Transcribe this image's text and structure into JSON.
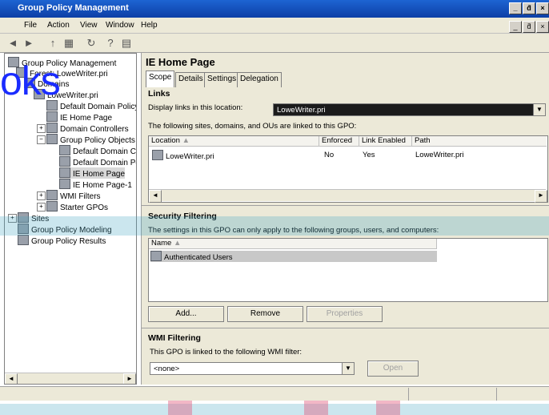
{
  "window": {
    "title": "Group Policy Management",
    "controls": [
      "_",
      "ƌ",
      "×"
    ]
  },
  "menu": [
    "File",
    "Action",
    "View",
    "Window",
    "Help"
  ],
  "toolbar_icons": [
    "back-icon",
    "forward-icon",
    "up-icon",
    "show-hide-icon",
    "refresh-icon",
    "help-icon",
    "console-icon"
  ],
  "tree": {
    "items": [
      {
        "label": "Group Policy Management",
        "depth": 0
      },
      {
        "label": "Forest: LoweWriter.pri",
        "depth": 1
      },
      {
        "label": "Domains",
        "depth": 2
      },
      {
        "label": "LoweWriter.pri",
        "depth": 3
      },
      {
        "label": "Default Domain Policy",
        "depth": 4
      },
      {
        "label": "IE Home Page",
        "depth": 4
      },
      {
        "label": "Domain Controllers",
        "depth": 4
      },
      {
        "label": "Group Policy Objects",
        "depth": 4
      },
      {
        "label": "Default Domain Co",
        "depth": 5
      },
      {
        "label": "Default Domain Po",
        "depth": 5
      },
      {
        "label": "IE Home Page",
        "depth": 5
      },
      {
        "label": "IE Home Page-1",
        "depth": 5
      },
      {
        "label": "WMI Filters",
        "depth": 4
      },
      {
        "label": "Starter GPOs",
        "depth": 4
      },
      {
        "label": "Sites",
        "depth": 1
      },
      {
        "label": "Group Policy Modeling",
        "depth": 1
      },
      {
        "label": "Group Policy Results",
        "depth": 1
      }
    ]
  },
  "watermark": "oks",
  "right": {
    "title": "IE Home Page",
    "tabs": [
      "Scope",
      "Details",
      "Settings",
      "Delegation"
    ],
    "links": {
      "heading": "Links",
      "display_label": "Display links in this location:",
      "display_value": "LoweWriter.pri",
      "info": "The following sites, domains, and OUs are linked to this GPO:",
      "columns": [
        "Location",
        "Enforced",
        "Link Enabled",
        "Path"
      ],
      "rows": [
        [
          "LoweWriter.pri",
          "No",
          "Yes",
          "LoweWriter.pri"
        ]
      ]
    },
    "security": {
      "heading": "Security Filtering",
      "info": "The settings in this GPO can only apply to the following groups, users, and computers:",
      "column": "Name",
      "rows": [
        "Authenticated Users"
      ],
      "buttons": [
        "Add...",
        "Remove",
        "Properties"
      ]
    },
    "wmi": {
      "heading": "WMI Filtering",
      "info": "This GPO is linked to the following WMI filter:",
      "value": "<none>",
      "button": "Open"
    }
  }
}
